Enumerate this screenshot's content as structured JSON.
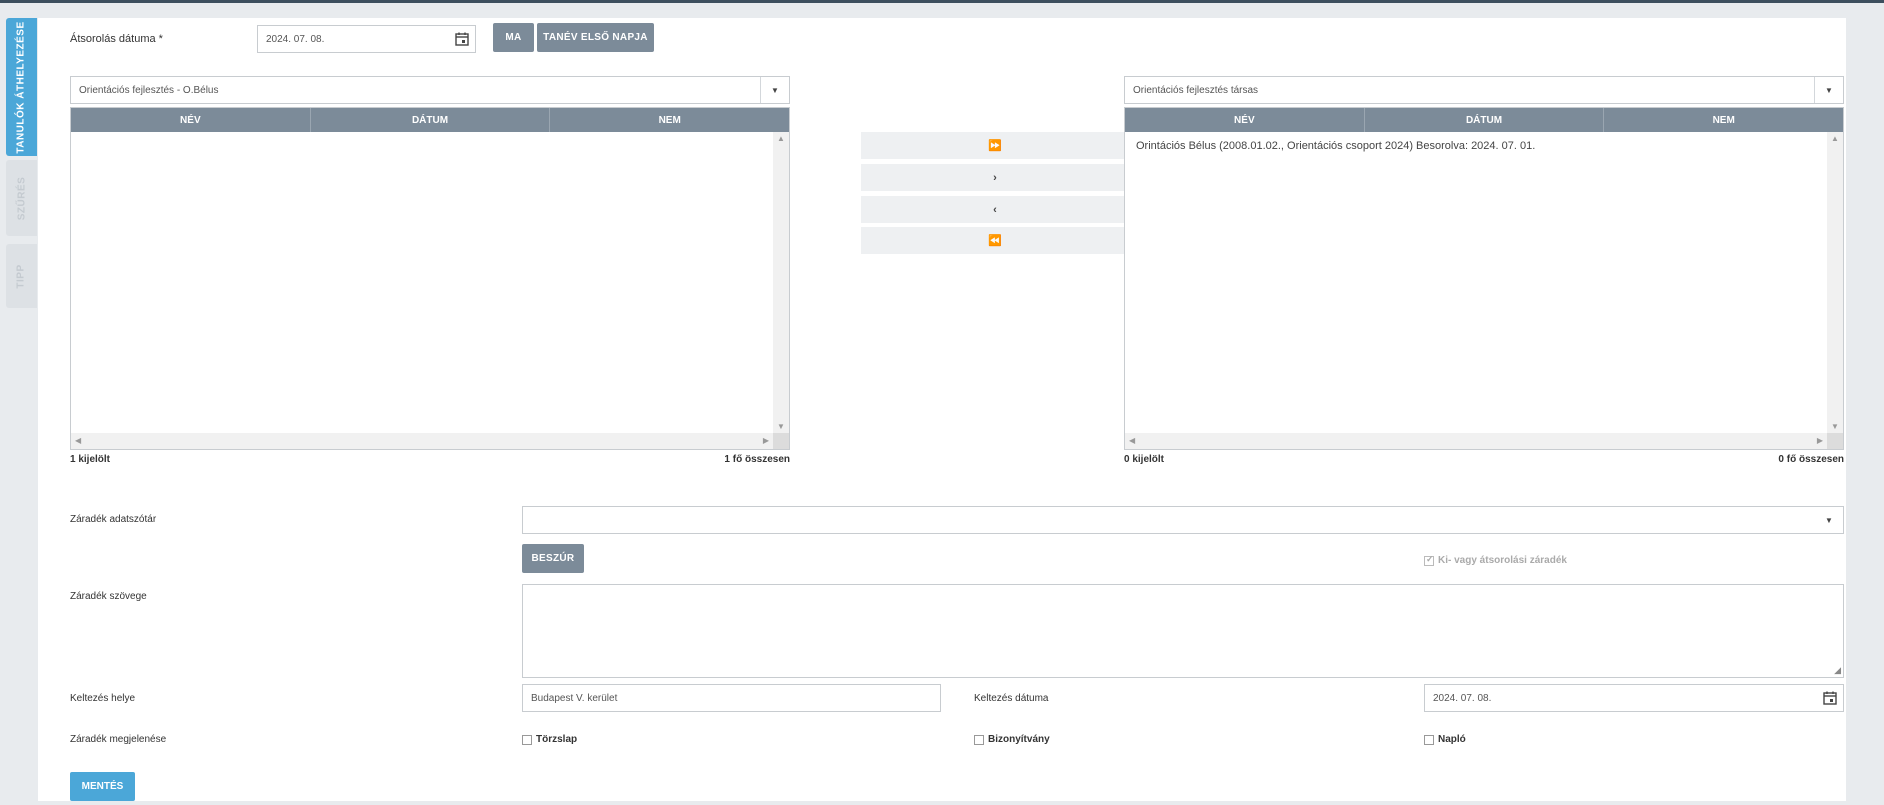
{
  "side_tabs": [
    "TANULÓK ÁTHELYEZÉSE",
    "SZŰRÉS",
    "TIPP"
  ],
  "transfer_date": {
    "label": "Átsorolás dátuma *",
    "value": "2024. 07. 08.",
    "today_button": "MA",
    "first_day_button": "TANÉV ELSŐ NAPJA"
  },
  "left_list": {
    "group": "Orientációs fejlesztés - O.Bélus",
    "columns": [
      "NÉV",
      "DÁTUM",
      "NEM"
    ],
    "rows": [],
    "selected": "1 kijelölt",
    "total": "1 fő összesen"
  },
  "right_list": {
    "group": "Orientációs fejlesztés társas",
    "columns": [
      "NÉV",
      "DÁTUM",
      "NEM"
    ],
    "rows": [
      "Orintációs Bélus (2008.01.02., Orientációs csoport 2024) Besorolva: 2024. 07. 01."
    ],
    "selected": "0 kijelölt",
    "total": "0 fő összesen"
  },
  "move_buttons": [
    "⏩",
    "›",
    "‹",
    "⏪"
  ],
  "clause": {
    "dictionary_label": "Záradék adatszótár",
    "dictionary_value": "",
    "insert_button": "BESZÚR",
    "exit_clause_label": "Ki- vagy átsorolási záradék",
    "text_label": "Záradék szövege",
    "text_value": ""
  },
  "issue_place": {
    "label": "Keltezés helye",
    "value": "Budapest V. kerület"
  },
  "issue_date": {
    "label": "Keltezés dátuma",
    "value": "2024. 07. 08."
  },
  "appearance": {
    "label": "Záradék megjelenése",
    "options": [
      "Törzslap",
      "Bizonyítvány",
      "Napló"
    ]
  },
  "save_button": "MENTÉS"
}
